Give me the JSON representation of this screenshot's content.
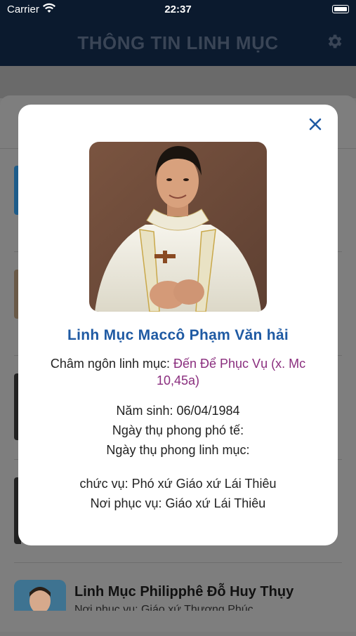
{
  "status_bar": {
    "carrier": "Carrier",
    "time": "22:37"
  },
  "nav": {
    "title": "THÔNG TIN LINH MỤC",
    "settings_icon": "gear-icon"
  },
  "background_list": {
    "visible_row": {
      "name": "Linh Mục Philipphê Đỗ Huy Thụy",
      "place": "Nơi phục vụ: Giáo xứ Thượng Phúc"
    }
  },
  "modal": {
    "close_icon": "close-icon",
    "name": "Linh Mục Maccô Phạm Văn hải",
    "motto_label": "Châm ngôn linh mục: ",
    "motto_value": "Đến Để Phục Vụ (x. Mc 10,45a)",
    "birth": "Năm sinh: 06/04/1984",
    "deacon_ordination": "Ngày thụ phong phó tế:",
    "priest_ordination": "Ngày thụ phong linh mục:",
    "position": "chức vụ: Phó xứ Giáo xứ Lái Thiêu",
    "service_place": "Nơi phục vụ: Giáo xứ Lái Thiêu"
  },
  "colors": {
    "nav_bg": "#0b1a2e",
    "name_blue": "#1f5aa3",
    "motto_purple": "#8a2e7e"
  }
}
